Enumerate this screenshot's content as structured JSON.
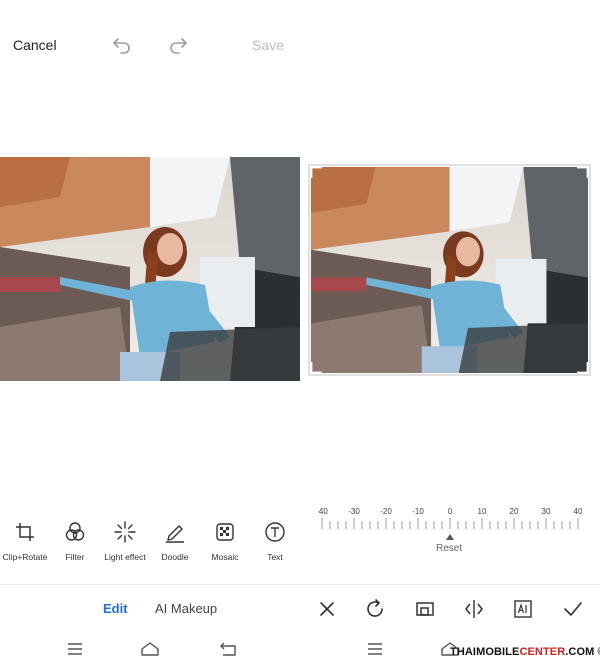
{
  "header": {
    "cancel_label": "Cancel",
    "save_label": "Save",
    "save_enabled": false
  },
  "tools": [
    {
      "label": "Clip+Rotate",
      "icon": "crop-icon"
    },
    {
      "label": "Filter",
      "icon": "filter-circles-icon"
    },
    {
      "label": "Light effect",
      "icon": "sparkle-icon"
    },
    {
      "label": "Doodle",
      "icon": "pen-icon"
    },
    {
      "label": "Mosaic",
      "icon": "mosaic-icon"
    },
    {
      "label": "Text",
      "icon": "text-icon"
    }
  ],
  "ruler": {
    "ticks": [
      "-40",
      "-30",
      "-20",
      "-10",
      "0",
      "10",
      "20",
      "30",
      "40"
    ],
    "current_value": 0,
    "reset_label": "Reset"
  },
  "mode_tabs": {
    "edit_label": "Edit",
    "ai_label": "AI Makeup",
    "active": "Edit"
  },
  "actions": [
    "close-icon",
    "rotate-icon",
    "aspect-ratio-icon",
    "flip-icon",
    "ai-icon",
    "check-icon"
  ],
  "navigation": [
    "menu-icon",
    "home-icon",
    "back-icon"
  ],
  "watermark": {
    "part1": "THAIMOBILE",
    "part2": "CENTER",
    "part3": ".COM"
  },
  "colors": {
    "accent": "#1f6fe5",
    "disabled": "#bdbdbd",
    "watermark_red": "#d32020"
  }
}
